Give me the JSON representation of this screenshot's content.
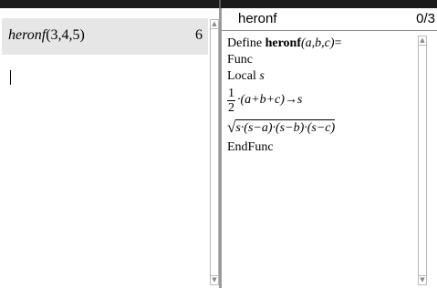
{
  "calculator": {
    "history": [
      {
        "expression_func": "heronf",
        "expression_args": "(3,4,5)",
        "result": "6"
      }
    ]
  },
  "editor": {
    "program_name": "heronf",
    "line_counter": "0/3",
    "define_prefix": "Define ",
    "function_name": "heronf",
    "params": "(a,b,c)",
    "define_suffix": "=",
    "func_keyword": "Func",
    "local_keyword": "Local ",
    "local_var": "s",
    "frac_num": "1",
    "frac_den": "2",
    "assign_expr": "·(a+b+c)→s",
    "sqrt_radicand": "s·(s−a)·(s−b)·(s−c)",
    "endfunc_keyword": "EndFunc"
  },
  "icons": {
    "scroll_up": "scroll-up-arrow",
    "scroll_down": "scroll-down-arrow"
  }
}
